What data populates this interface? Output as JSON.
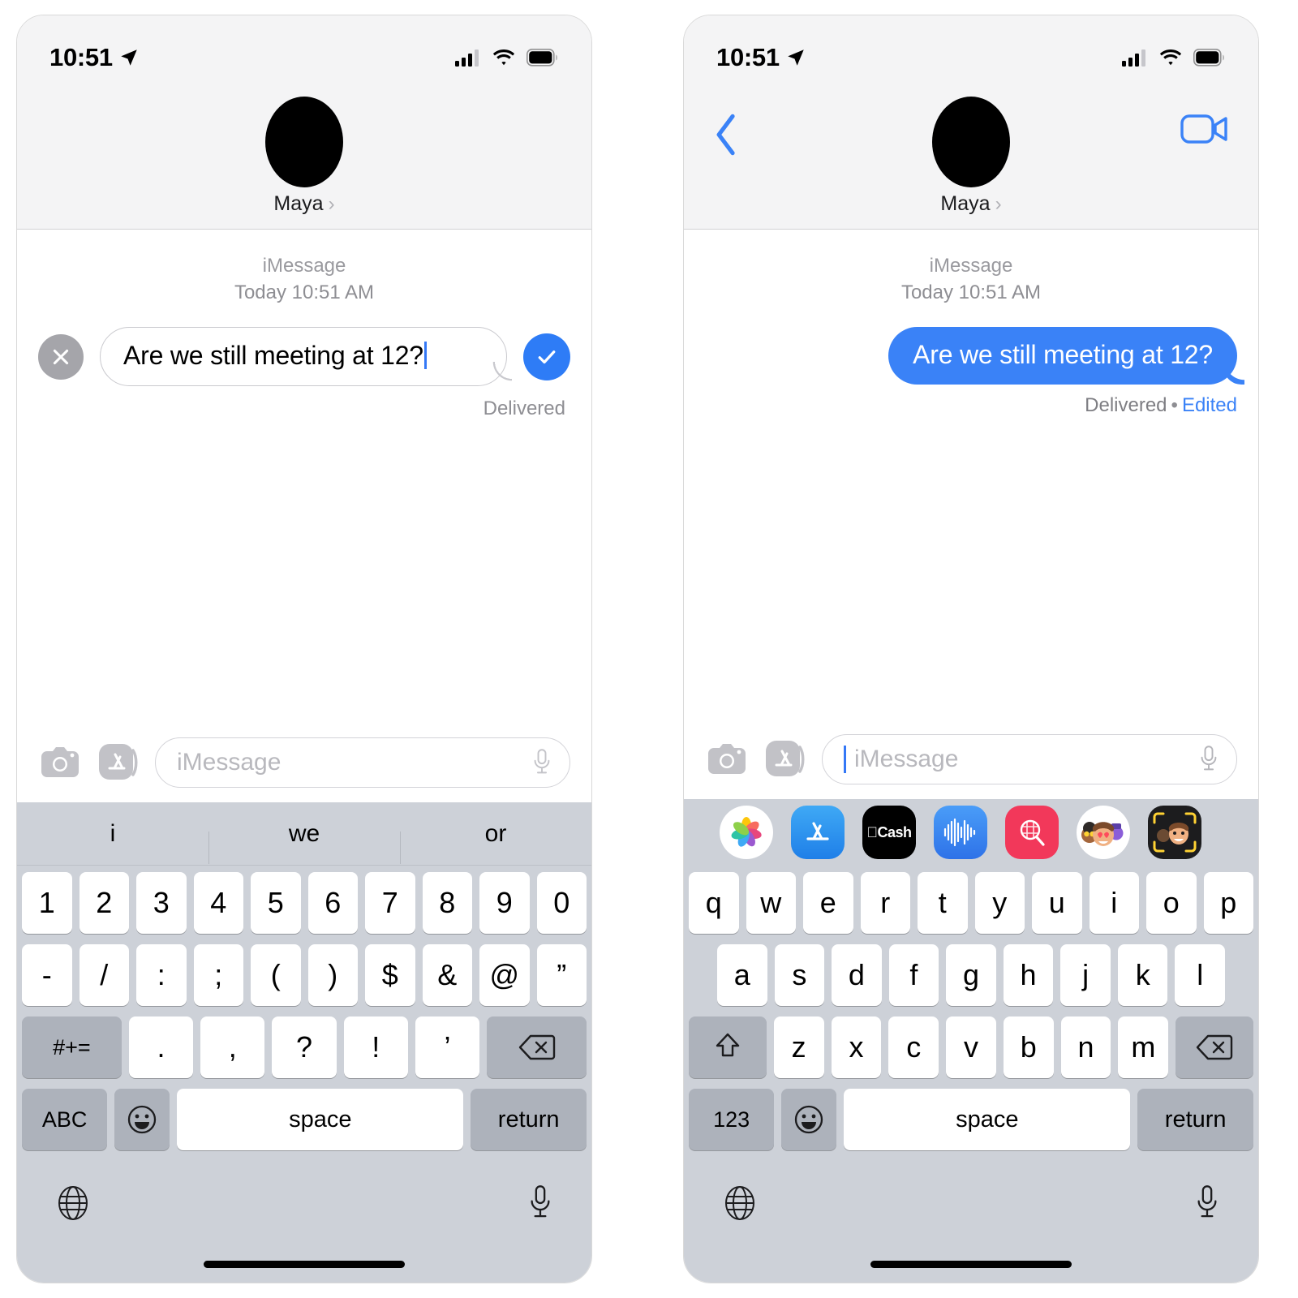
{
  "panels": [
    {
      "id": "editing",
      "status_bar": {
        "time": "10:51",
        "location_icon": "location-arrow-icon",
        "signal_icon": "cellular-signal-icon",
        "wifi_icon": "wifi-icon",
        "battery_icon": "battery-full-icon"
      },
      "nav": {
        "show_back": false,
        "show_facetime": false,
        "contact_name": "Maya",
        "chevron": "›"
      },
      "thread": {
        "service": "iMessage",
        "timestamp": "Today 10:51 AM",
        "mode": "edit",
        "message_text": "Are we still meeting at 12?",
        "cancel_label": "✕",
        "confirm_label": "✓",
        "delivery_status": "Delivered"
      },
      "input_bar": {
        "camera_icon": "camera-icon",
        "apps_icon": "app-store-icon",
        "placeholder": "iMessage",
        "mic_icon": "microphone-icon",
        "caret_visible": false
      },
      "keyboard": {
        "type": "numeric-symbol",
        "predictive": [
          "i",
          "we",
          "or"
        ],
        "app_drawer": [],
        "rows": [
          [
            "1",
            "2",
            "3",
            "4",
            "5",
            "6",
            "7",
            "8",
            "9",
            "0"
          ],
          [
            "-",
            "/",
            ":",
            ";",
            "(",
            ")",
            "$",
            "&",
            "@",
            "”"
          ],
          [
            "#+=",
            ".",
            ",",
            "?",
            "!",
            "’",
            "backspace-icon"
          ],
          [
            "ABC",
            "emoji-icon",
            "space",
            "return"
          ]
        ],
        "space_label": "space",
        "return_label": "return",
        "globe_icon": "globe-icon",
        "dictation_icon": "microphone-icon"
      }
    },
    {
      "id": "sent",
      "status_bar": {
        "time": "10:51",
        "location_icon": "location-arrow-icon",
        "signal_icon": "cellular-signal-icon",
        "wifi_icon": "wifi-icon",
        "battery_icon": "battery-full-icon"
      },
      "nav": {
        "show_back": true,
        "show_facetime": true,
        "contact_name": "Maya",
        "chevron": "›"
      },
      "thread": {
        "service": "iMessage",
        "timestamp": "Today 10:51 AM",
        "mode": "sent",
        "message_text": "Are we still meeting at 12?",
        "delivery_status": "Delivered",
        "separator": "•",
        "edited_label": "Edited"
      },
      "input_bar": {
        "camera_icon": "camera-icon",
        "apps_icon": "app-store-icon",
        "placeholder": "iMessage",
        "mic_icon": "microphone-icon",
        "caret_visible": true
      },
      "keyboard": {
        "type": "qwerty",
        "predictive": [],
        "app_drawer": [
          "photos-icon",
          "app-store-icon",
          "apple-cash-icon",
          "audio-message-icon",
          "gif-search-icon",
          "memoji-stickers-icon",
          "memoji-icon"
        ],
        "rows": [
          [
            "q",
            "w",
            "e",
            "r",
            "t",
            "y",
            "u",
            "i",
            "o",
            "p"
          ],
          [
            "a",
            "s",
            "d",
            "f",
            "g",
            "h",
            "j",
            "k",
            "l"
          ],
          [
            "shift-icon",
            "z",
            "x",
            "c",
            "v",
            "b",
            "n",
            "m",
            "backspace-icon"
          ],
          [
            "123",
            "emoji-icon",
            "space",
            "return"
          ]
        ],
        "space_label": "space",
        "return_label": "return",
        "globe_icon": "globe-icon",
        "dictation_icon": "microphone-icon"
      }
    }
  ],
  "colors": {
    "imessage_blue": "#3a82f7",
    "accent_blue": "#2e7cf6",
    "cancel_gray": "#a5a5aa",
    "keyboard_bg": "#cdd1d8",
    "nav_bg": "#f4f4f5",
    "meta_gray": "#8e8e93"
  }
}
